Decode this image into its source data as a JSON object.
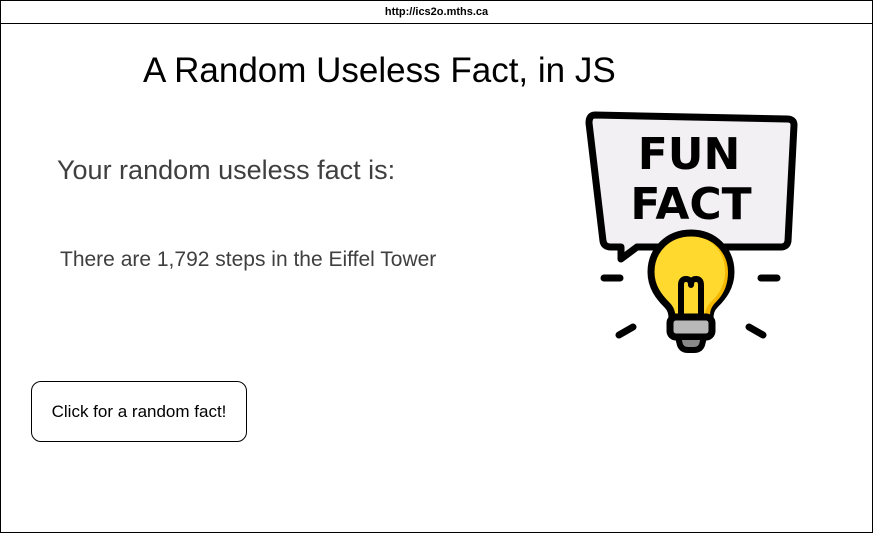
{
  "browser": {
    "url": "http://ics2o.mths.ca"
  },
  "page": {
    "title": "A Random Useless Fact, in JS",
    "fact_heading": "Your random useless fact is:",
    "fact_text": "There are 1,792 steps in the Eiffel Tower",
    "button_label": "Click for a random fact!"
  },
  "image": {
    "name": "fun-fact-lightbulb",
    "line1": "FUN",
    "line2": "FACT",
    "colors": {
      "bulb": "#ffd92e",
      "bulb_shade": "#f5b800",
      "bubble": "#f2f0f2",
      "outline": "#000000",
      "base": "#b8b8b8"
    }
  }
}
